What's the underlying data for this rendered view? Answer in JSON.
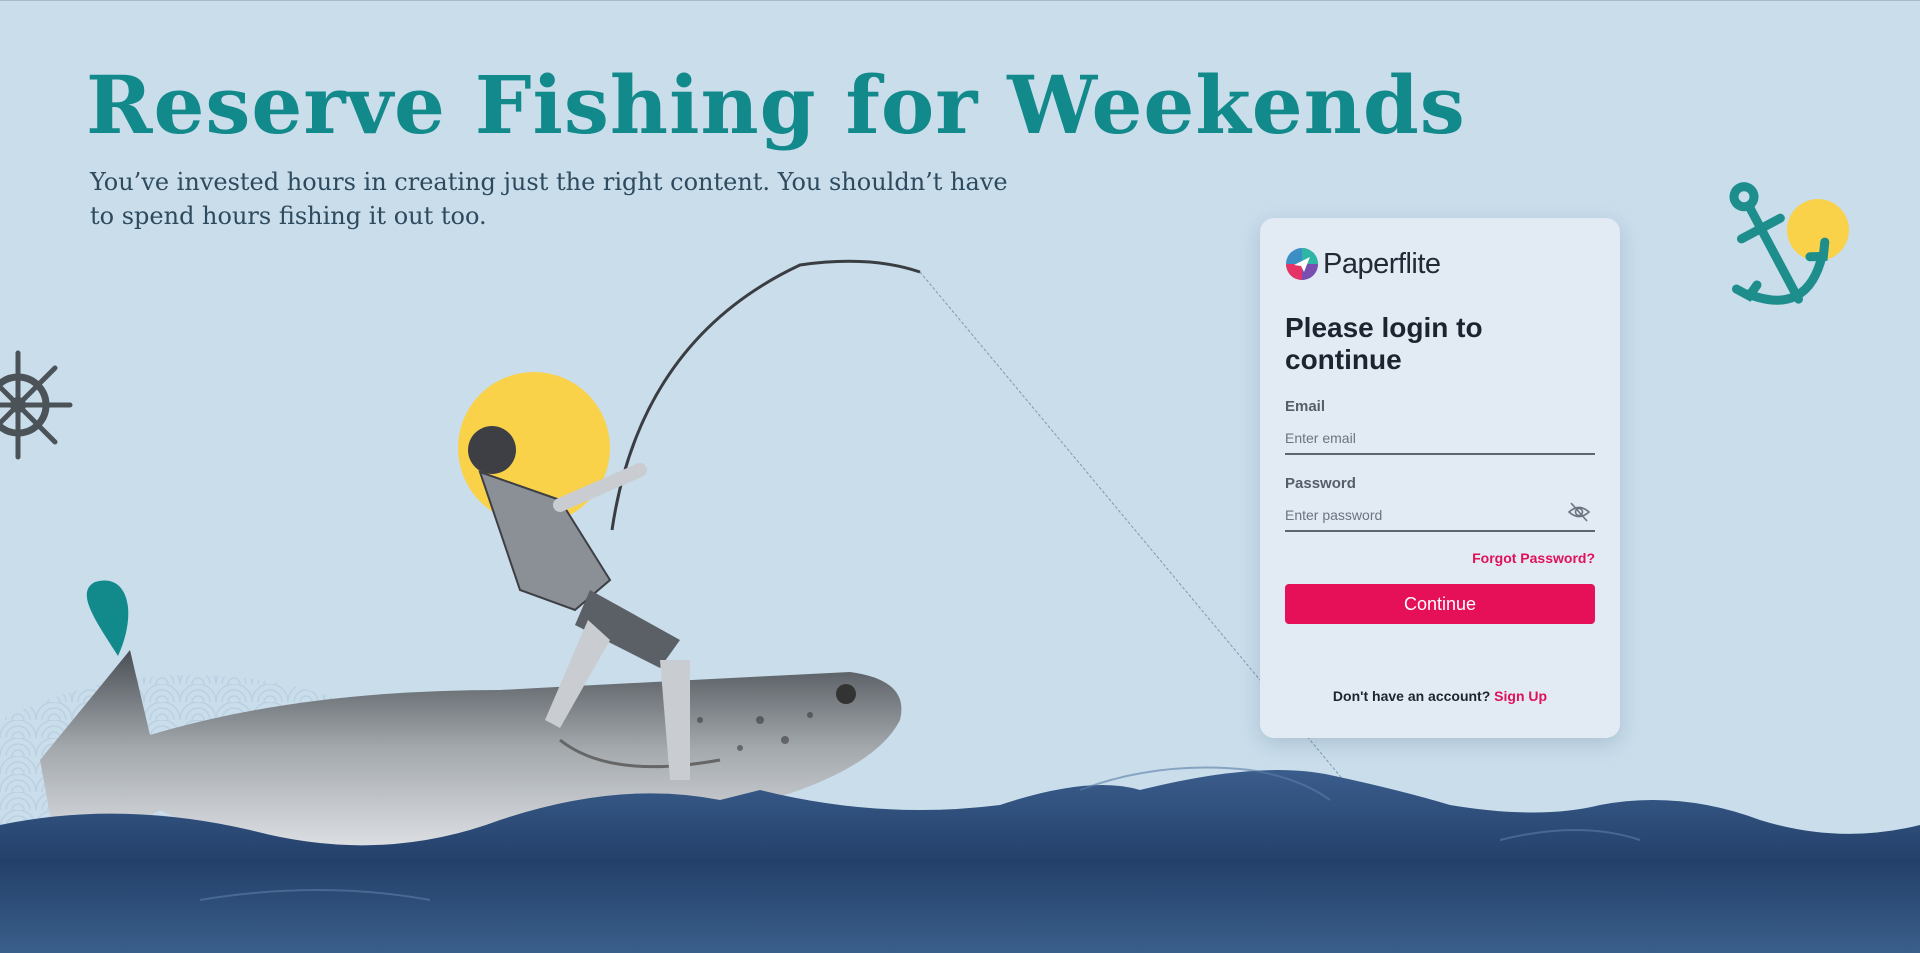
{
  "hero": {
    "title": "Reserve Fishing for Weekends",
    "subtitle_line1": "You’ve invested hours in creating just the right content. You shouldn’t have",
    "subtitle_line2": "to spend hours fishing it out too."
  },
  "brand": {
    "name": "Paperflite",
    "logo_icon": "paperflite-logo-icon"
  },
  "login": {
    "title": "Please login to continue",
    "email_label": "Email",
    "email_placeholder": "Enter email",
    "email_value": "",
    "password_label": "Password",
    "password_placeholder": "Enter password",
    "password_value": "",
    "password_toggle_icon": "eye-slash-icon",
    "forgot_label": "Forgot Password?",
    "continue_label": "Continue",
    "signup_prompt": "Don't have an account?",
    "signup_label": "Sign Up"
  },
  "colors": {
    "background": "#c9ddeb",
    "hero_title": "#12898a",
    "accent": "#e61058",
    "sun": "#f9d24a",
    "sea": "#2c4a72"
  },
  "decorations": [
    "ship-wheel-icon",
    "anchor-icon",
    "sun-circle",
    "fisherman-illustration",
    "fish-illustration",
    "waves"
  ]
}
